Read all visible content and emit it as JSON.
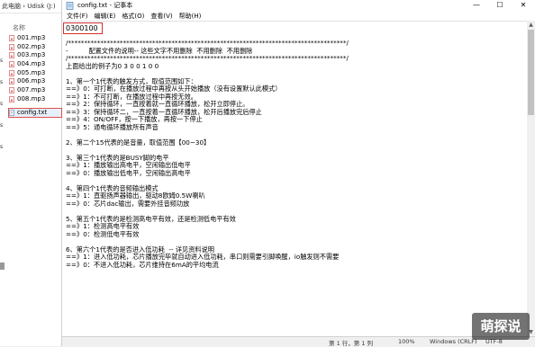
{
  "explorer": {
    "breadcrumb_left": "此电脑",
    "breadcrumb_right": "Udisk (J:)",
    "column_header": "名称",
    "nav_letters": [
      "s",
      "s",
      "s",
      "s",
      "s"
    ],
    "files": [
      {
        "name": "001.mp3",
        "type": "mp3"
      },
      {
        "name": "002.mp3",
        "type": "mp3"
      },
      {
        "name": "003.mp3",
        "type": "mp3"
      },
      {
        "name": "004.mp3",
        "type": "mp3"
      },
      {
        "name": "005.mp3",
        "type": "mp3"
      },
      {
        "name": "006.mp3",
        "type": "mp3"
      },
      {
        "name": "007.mp3",
        "type": "mp3"
      },
      {
        "name": "008.mp3",
        "type": "mp3"
      }
    ],
    "selected_file": "config.txt"
  },
  "window": {
    "title": "config.txt - 记事本",
    "minimize": "—",
    "maximize": "☐",
    "close": "✕"
  },
  "menu": [
    "文件(F)",
    "编辑(E)",
    "格式(O)",
    "查看(V)",
    "帮助(H)"
  ],
  "editor": {
    "first_line": "0300100",
    "lines": [
      "/**************************************************************************************/",
      "-          配置文件的说明-- 这些文字不用删除  不用删除  不用删除",
      "/**************************************************************************************/",
      "上面给出的例子为0 3 0 0 1 0 0",
      "",
      "1、第一个1代表的触发方式，取值范围如下：",
      "==》0：可打断，在播放过程中再按从头开始播放（没有设置默认此模式）",
      "==》1：不可打断，在播放过程中再按无效。",
      "==》2：保持循环，一直按着就一直循环播放，松开立即停止。",
      "==》3：保持循环二，一直按着一直循环播放，松开后播放完后停止",
      "==》4：ON/OFF，按一下播放，再按一下停止",
      "==》5：通电循环播放所有声音",
      "",
      "2、第二个15代表的是音量，取值范围【00~30】",
      "",
      "3、第三个1代表的是BUSY脚的电平",
      "==》1：播放输出高电平，空闲输出低电平",
      "==》0：播放输出低电平，空闲输出高电平",
      "",
      "4、第四个1代表的音频输出模式",
      "==》1：直驱扬声器输出，驱动8欧姆0.5W喇叭",
      "==》0：芯片dac输出，需要外挂音频功放",
      "",
      "5、第五个1代表的是检测高电平有效，还是检测低电平有效",
      "==》1：检测高电平有效",
      "==》0：检测低电平有效",
      "",
      "6、第六个1代表的是否进入低功耗  -- 详见资料说明",
      "==》1：进入低功耗，芯片播放完毕就自动进入低功耗，串口则需要引脚唤醒，io触发则不需要",
      "==》0：不进入低功耗，芯片维持在6mA的平均电流"
    ]
  },
  "scrollbar": {
    "up": "▲",
    "down": "▼"
  },
  "status": {
    "position": "第 1 行，第 1 列",
    "zoom": "100%",
    "line_ending": "Windows (CRLF)",
    "encoding": "UTF-8"
  },
  "watermark": "萌探说"
}
